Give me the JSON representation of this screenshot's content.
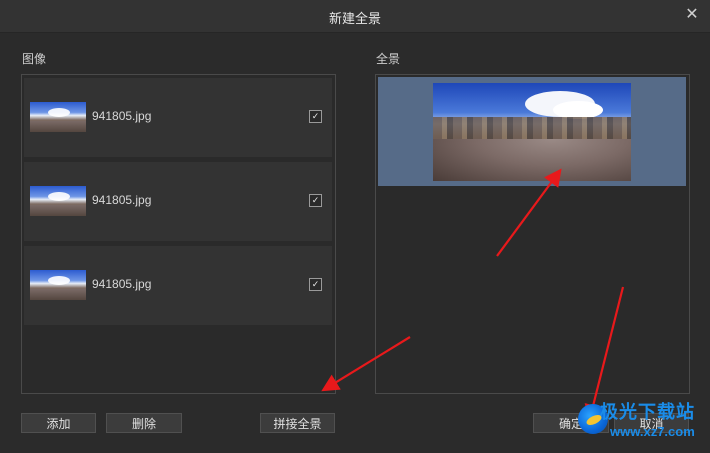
{
  "window": {
    "title": "新建全景"
  },
  "left_panel": {
    "label": "图像",
    "items": [
      {
        "filename": "941805.jpg",
        "checked": true
      },
      {
        "filename": "941805.jpg",
        "checked": true
      },
      {
        "filename": "941805.jpg",
        "checked": true
      }
    ]
  },
  "right_panel": {
    "label": "全景"
  },
  "buttons": {
    "add": "添加",
    "delete": "删除",
    "stitch": "拼接全景",
    "ok": "确定",
    "cancel": "取消"
  },
  "check_glyph": "✓",
  "close_glyph": "✕",
  "watermark": {
    "text": "极光下载站",
    "url": "www.xz7.com"
  },
  "colors": {
    "background": "#2b2b2b",
    "selection": "#566b88",
    "arrow": "#e8191b",
    "watermark": "#1a8ce8"
  }
}
